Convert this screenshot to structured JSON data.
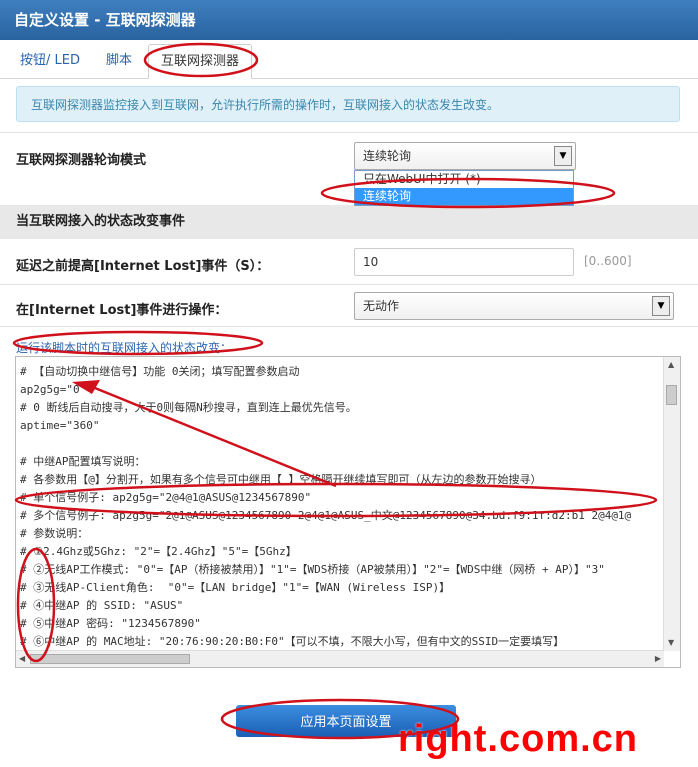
{
  "window": {
    "title": "自定义设置 - 互联网探测器"
  },
  "tabs": [
    {
      "label": "按钮/ LED"
    },
    {
      "label": "脚本"
    },
    {
      "label": "互联网探测器"
    }
  ],
  "info_text": "互联网探测器监控接入到互联网，允许执行所需的操作时，互联网接入的状态发生改变。",
  "poll_mode": {
    "label": "互联网探测器轮询模式",
    "value": "连续轮询",
    "options": [
      "只在WebUI中打开 (*)",
      "连续轮询"
    ]
  },
  "section_title": "当互联网接入的状态改变事件",
  "delay": {
    "label": "延迟之前提高[Internet Lost]事件（S）：",
    "value": "10",
    "hint": "[0..600]"
  },
  "action": {
    "label": "在[Internet Lost]事件进行操作：",
    "value": "无动作"
  },
  "script": {
    "label": "运行该脚本时的互联网接入的状态改变：",
    "lines": [
      "# 【自动切换中继信号】功能 0关闭；填写配置参数启动",
      "ap2g5g=\"0\"",
      "# 0 断线后自动搜寻，大于0则每隔N秒搜寻，直到连上最优先信号。",
      "aptime=\"360\"",
      "",
      "# 中继AP配置填写说明：",
      "# 各参数用【@】分割开，如果有多个信号可中继用【 】空格隔开继续填写即可（从左边的参数开始搜寻）",
      "# 单个信号例子: ap2g5g=\"2@4@1@ASUS@1234567890\"",
      "# 多个信号例子: ap2g5g=\"2@1@ASUS@1234567890 2@4@1@ASUS_中文@1234567890@34:bd:f9:1f:d2:b1 2@4@1@",
      "# 参数说明：",
      "# ①2.4Ghz或5Ghz: \"2\"=【2.4Ghz】\"5\"=【5Ghz】",
      "# ②无线AP工作模式: \"0\"=【AP（桥接被禁用）】\"1\"=【WDS桥接（AP被禁用）】\"2\"=【WDS中继（网桥 + AP）】\"3\"",
      "# ③无线AP-Client角色:  \"0\"=【LAN bridge】\"1\"=【WAN (Wireless ISP)】",
      "# ④中继AP 的 SSID: \"ASUS\"",
      "# ⑤中继AP 密码: \"1234567890\"",
      "# ⑥中继AP 的 MAC地址: \"20:76:90:20:B0:F0\"【可以不填，不限大小写，但有中文的SSID一定要填写】"
    ]
  },
  "apply_button": "应用本页面设置",
  "watermark": "right.com.cn",
  "colors": {
    "titlebar": "#2f6fb0",
    "link": "#2a64b0",
    "annotation": "#d0101a",
    "watermark": "#ff0000"
  }
}
